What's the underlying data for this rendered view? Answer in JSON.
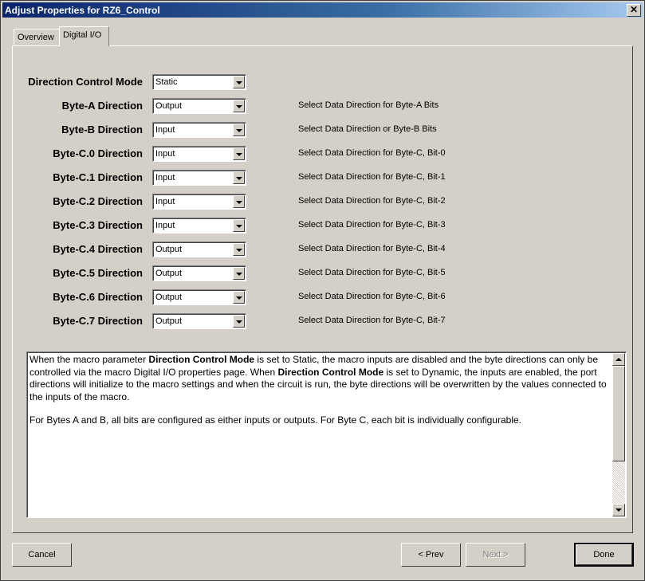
{
  "window": {
    "title": "Adjust Properties for RZ6_Control",
    "close_glyph": "✕"
  },
  "tabs": [
    {
      "label": "Overview"
    },
    {
      "label": "Digital I/O"
    }
  ],
  "rows": [
    {
      "label": "Direction Control Mode",
      "value": "Static",
      "description": ""
    },
    {
      "label": "Byte-A Direction",
      "value": "Output",
      "description": "Select Data Direction for Byte-A Bits"
    },
    {
      "label": "Byte-B Direction",
      "value": "Input",
      "description": "Select Data Direction or Byte-B Bits"
    },
    {
      "label": "Byte-C.0 Direction",
      "value": "Input",
      "description": "Select Data Direction for Byte-C, Bit-0"
    },
    {
      "label": "Byte-C.1 Direction",
      "value": "Input",
      "description": "Select Data Direction for Byte-C, Bit-1"
    },
    {
      "label": "Byte-C.2 Direction",
      "value": "Input",
      "description": "Select Data Direction for Byte-C, Bit-2"
    },
    {
      "label": "Byte-C.3 Direction",
      "value": "Input",
      "description": "Select Data Direction for Byte-C, Bit-3"
    },
    {
      "label": "Byte-C.4 Direction",
      "value": "Output",
      "description": "Select Data Direction for Byte-C, Bit-4"
    },
    {
      "label": "Byte-C.5 Direction",
      "value": "Output",
      "description": "Select Data Direction for Byte-C, Bit-5"
    },
    {
      "label": "Byte-C.6 Direction",
      "value": "Output",
      "description": "Select Data Direction for Byte-C, Bit-6"
    },
    {
      "label": "Byte-C.7 Direction",
      "value": "Output",
      "description": "Select Data Direction for Byte-C, Bit-7"
    }
  ],
  "help": {
    "p1_a": "When the macro parameter ",
    "p1_b": "Direction Control Mode",
    "p1_c": " is set to Static, the macro inputs are disabled and the byte directions can only be controlled via the macro Digital I/O properties page. When ",
    "p1_d": "Direction Control Mode",
    "p1_e": " is set to Dynamic, the inputs are enabled, the port directions will initialize to the macro settings and when the circuit is run, the byte directions will be overwritten by the values connected to the inputs of the macro.",
    "p2": "For Bytes A and B, all bits are configured as either inputs or outputs. For Byte C, each bit is individually configurable."
  },
  "buttons": {
    "cancel": "Cancel",
    "prev": "< Prev",
    "next": "Next >",
    "done": "Done"
  }
}
